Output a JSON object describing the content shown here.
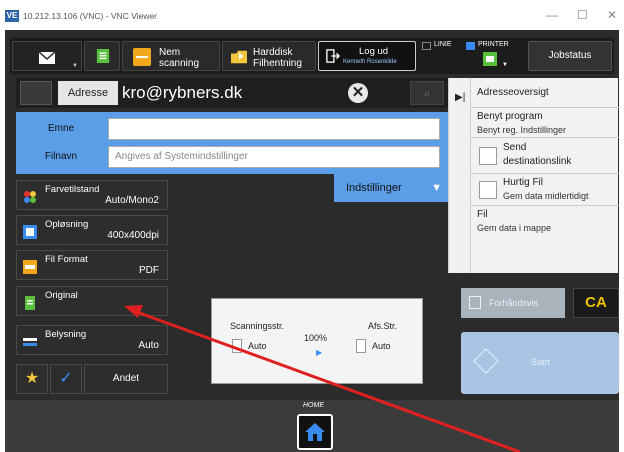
{
  "window": {
    "title": "10.212.13.106 (VNC) - VNC Viewer",
    "logo_text": "VE",
    "minimize": "—",
    "maximize": "☐",
    "close": "✕"
  },
  "toolbar": {
    "scan_label": "Nem\nscanning",
    "hdd_label": "Harddisk\nFilhentning",
    "logout_label": "Log ud",
    "logout_user": "Kenneth Rosenkilde",
    "linie_label": "LINIE",
    "printer_label": "PRINTER",
    "jobstatus_label": "Jobstatus"
  },
  "address": {
    "label": "Adresse",
    "value": "kro@rybners.dk"
  },
  "form": {
    "subject_label": "Emne",
    "subject_value": "",
    "filename_label": "Filnavn",
    "filename_placeholder": "Angives af Systemindstillinger"
  },
  "settings_tab": "Indstillinger",
  "functions": [
    {
      "name": "Farvetilstand",
      "value": "Auto/Mono2"
    },
    {
      "name": "Opløsning",
      "value": "400x400dpi"
    },
    {
      "name": "Fil Format",
      "value": "PDF"
    },
    {
      "name": "Original",
      "value": ""
    },
    {
      "name": "Belysning",
      "value": "Auto"
    }
  ],
  "quick": {
    "other_label": "Andet"
  },
  "summary": {
    "scan_size_label": "Scanningsstr.",
    "scan_size_value": "Auto",
    "ratio": "100%",
    "send_size_label": "Afs.Str.",
    "send_size_value": "Auto"
  },
  "side_panel": {
    "address_overview": "Adresseoversigt",
    "use_program": "Benyt program",
    "use_program_sub": "Benyt reg. Indstillinger",
    "send_link": "Send",
    "send_link_sub": "destinationslink",
    "quick_file": "Hurtig Fil",
    "quick_file_sub": "Gem data midlertidigt",
    "file": "Fil",
    "file_sub": "Gem data i mappe"
  },
  "controls": {
    "preview_label": "Forhåndsvis",
    "ca_label": "CA",
    "start_label": "Start"
  },
  "home": {
    "label": "HOME"
  },
  "colors": {
    "accent_blue": "#5a9ee8",
    "panel_dark": "#2b2b2b",
    "ca_yellow": "#f0c000",
    "annotation_red": "#e02020"
  }
}
